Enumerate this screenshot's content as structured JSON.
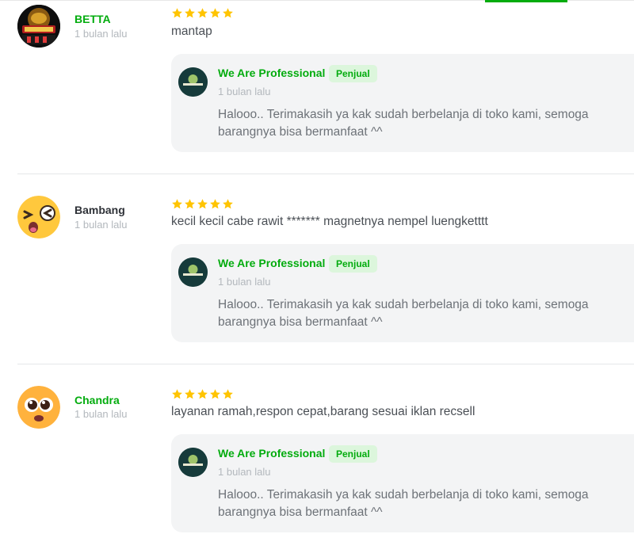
{
  "colors": {
    "accent": "#03ac0e",
    "star": "#ffc400"
  },
  "reviews": [
    {
      "avatar_icon": "betta-fish-avatar-icon",
      "name": "BETTA",
      "time": "1 bulan lalu",
      "rating": 5,
      "text": "mantap",
      "reply": {
        "seller_name": "We Are Professional",
        "badge": "Penjual",
        "time": "1 bulan lalu",
        "text": "Halooo.. Terimakasih ya kak sudah berbelanja di toko kami, semoga barangnya bisa bermanfaat ^^"
      }
    },
    {
      "avatar_icon": "squint-emoji-avatar-icon",
      "name": "Bambang",
      "time": "1 bulan lalu",
      "rating": 5,
      "text": "kecil kecil cabe rawit ******* magnetnya nempel luengketttt",
      "reply": {
        "seller_name": "We Are Professional",
        "badge": "Penjual",
        "time": "1 bulan lalu",
        "text": "Halooo.. Terimakasih ya kak sudah berbelanja di toko kami, semoga barangnya bisa bermanfaat ^^"
      }
    },
    {
      "avatar_icon": "pleading-emoji-avatar-icon",
      "name": "Chandra",
      "time": "1 bulan lalu",
      "rating": 5,
      "text": "layanan ramah,respon cepat,barang sesuai iklan recsell",
      "reply": {
        "seller_name": "We Are Professional",
        "badge": "Penjual",
        "time": "1 bulan lalu",
        "text": "Halooo.. Terimakasih ya kak sudah berbelanja di toko kami, semoga barangnya bisa bermanfaat ^^"
      }
    }
  ]
}
